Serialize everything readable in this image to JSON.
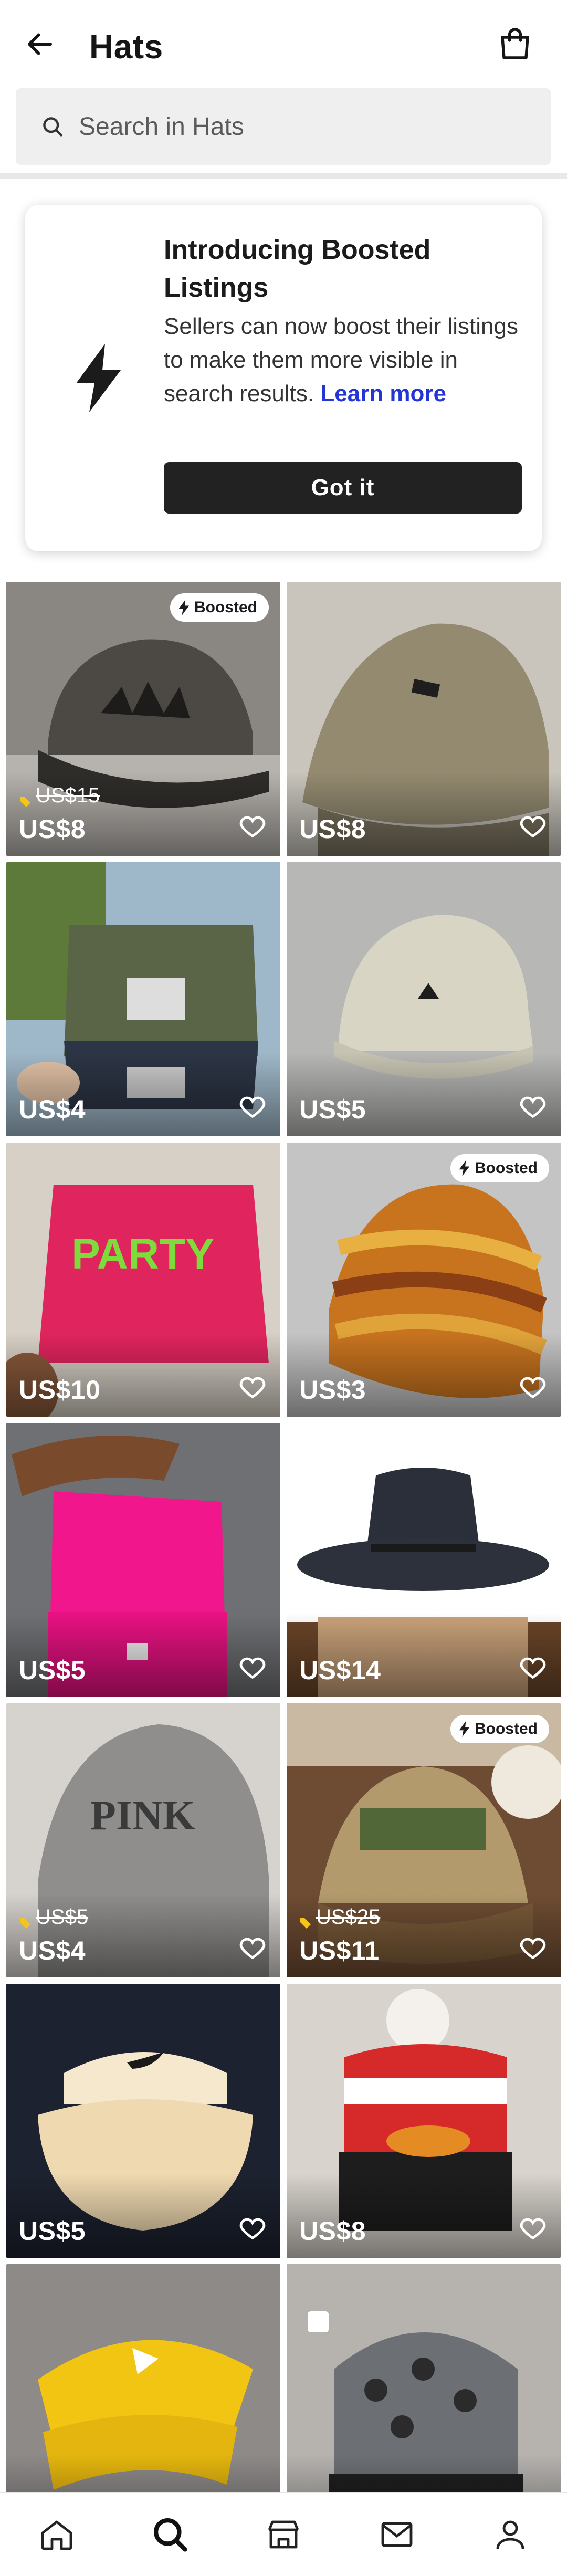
{
  "header": {
    "title": "Hats",
    "back_icon": "arrow-left-icon",
    "bag_icon": "shopping-bag-icon"
  },
  "search": {
    "placeholder": "Search in Hats",
    "icon": "search-icon"
  },
  "banner": {
    "icon": "lightning-icon",
    "title": "Introducing Boosted Listings",
    "body": "Sellers can now boost their listings to make them more visible in search results. ",
    "link_text": "Learn more",
    "button_label": "Got it"
  },
  "badge_label": "Boosted",
  "colors": {
    "primary_dark": "#222222",
    "link_blue": "#2336d4",
    "discount_tag": "#f5c518"
  },
  "listings": [
    {
      "price": "US$8",
      "old_price": "US$15",
      "boosted": true
    },
    {
      "price": "US$8",
      "old_price": "",
      "boosted": false
    },
    {
      "price": "US$4",
      "old_price": "",
      "boosted": false
    },
    {
      "price": "US$5",
      "old_price": "",
      "boosted": false
    },
    {
      "price": "US$10",
      "old_price": "",
      "boosted": false
    },
    {
      "price": "US$3",
      "old_price": "",
      "boosted": true
    },
    {
      "price": "US$5",
      "old_price": "",
      "boosted": false
    },
    {
      "price": "US$14",
      "old_price": "",
      "boosted": false
    },
    {
      "price": "US$4",
      "old_price": "US$5",
      "boosted": false
    },
    {
      "price": "US$11",
      "old_price": "US$25",
      "boosted": true
    },
    {
      "price": "US$5",
      "old_price": "",
      "boosted": false
    },
    {
      "price": "US$8",
      "old_price": "",
      "boosted": false
    },
    {
      "price": "",
      "old_price": "",
      "boosted": false
    },
    {
      "price": "",
      "old_price": "",
      "boosted": false
    }
  ],
  "bottom_nav": [
    {
      "name": "home",
      "icon": "home-icon"
    },
    {
      "name": "search",
      "icon": "search-icon",
      "active": true
    },
    {
      "name": "shop",
      "icon": "shop-icon"
    },
    {
      "name": "inbox",
      "icon": "mail-icon"
    },
    {
      "name": "profile",
      "icon": "profile-icon"
    }
  ]
}
